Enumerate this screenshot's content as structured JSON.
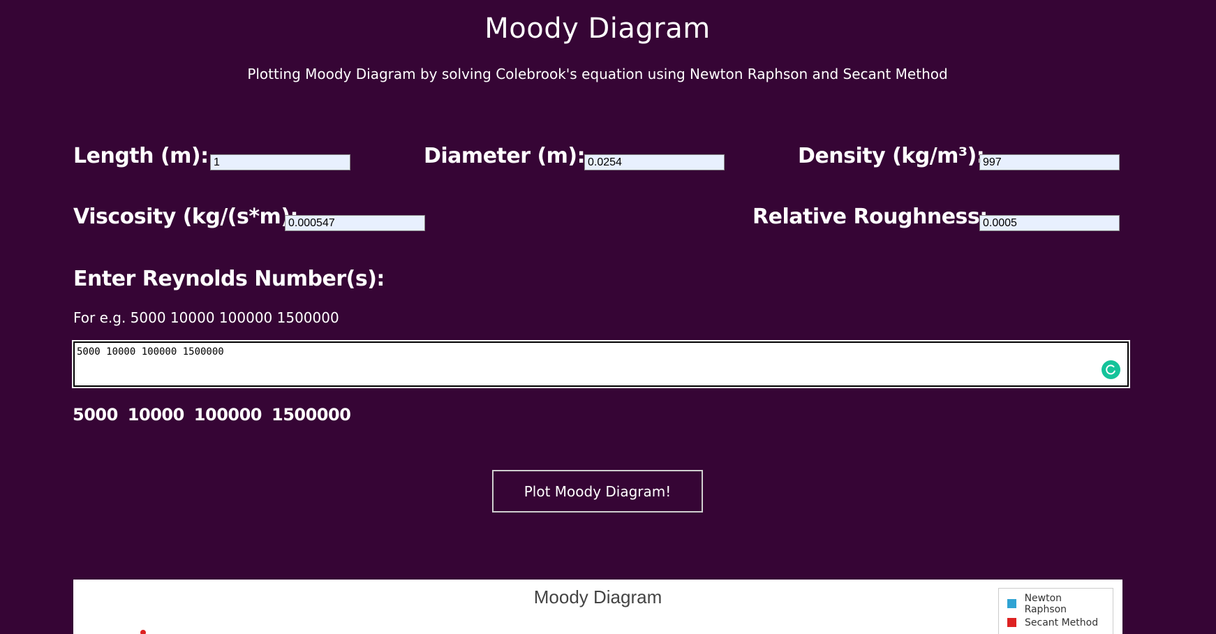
{
  "header": {
    "title": "Moody Diagram",
    "subtitle": "Plotting Moody Diagram by solving Colebrook's equation using Newton Raphson and Secant Method"
  },
  "fields": {
    "length": {
      "label": "Length (m):",
      "value": "1"
    },
    "diameter": {
      "label": "Diameter (m):",
      "value": "0.0254"
    },
    "density": {
      "label": "Density (kg/m³):",
      "value": "997"
    },
    "viscosity": {
      "label": "Viscosity (kg/(s*m):",
      "value": "0.000547"
    },
    "roughness": {
      "label": "Relative Roughness:",
      "value": "0.0005"
    }
  },
  "reynolds": {
    "heading": "Enter Reynolds Number(s):",
    "example": "For e.g. 5000 10000 100000 1500000",
    "input_value": "5000 10000 100000 1500000",
    "parsed": [
      "5000",
      "10000",
      "100000",
      "1500000"
    ]
  },
  "actions": {
    "plot_label": "Plot Moody Diagram!"
  },
  "chart": {
    "title": "Moody Diagram",
    "legend": [
      {
        "name": "Newton Raphson",
        "color": "#2fa3d3"
      },
      {
        "name": "Secant Method",
        "color": "#dd2222"
      }
    ]
  },
  "colors": {
    "background": "#360535",
    "grammarly": "#15c39a"
  }
}
